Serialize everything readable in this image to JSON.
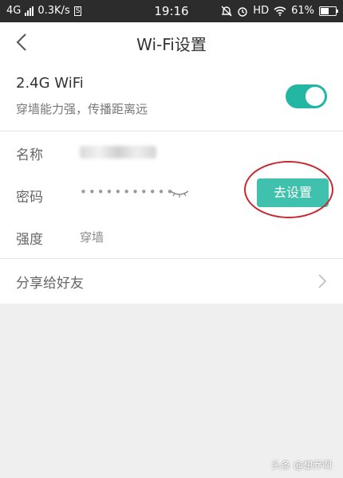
{
  "status_bar": {
    "network": "4G",
    "speed": "0.3K/s",
    "sim_badge": "S",
    "time": "19:16",
    "hd": "HD",
    "battery": "61%",
    "battery_level": 0.61
  },
  "nav": {
    "title": "Wi-Fi设置"
  },
  "wifi": {
    "name": "2.4G WiFi",
    "desc": "穿墙能力强，传播距离远",
    "enabled": true,
    "toggle_color": "#23b7a3"
  },
  "fields": {
    "name_label": "名称",
    "password_label": "密码",
    "password_masked": "•••••••••••",
    "strength_label": "强度",
    "strength_value": "穿墙",
    "set_button": "去设置"
  },
  "share": {
    "label": "分享给好友"
  },
  "watermark": "头条 @想乔啊",
  "colors": {
    "accent": "#40c1ad",
    "annotation": "#c8282e"
  }
}
